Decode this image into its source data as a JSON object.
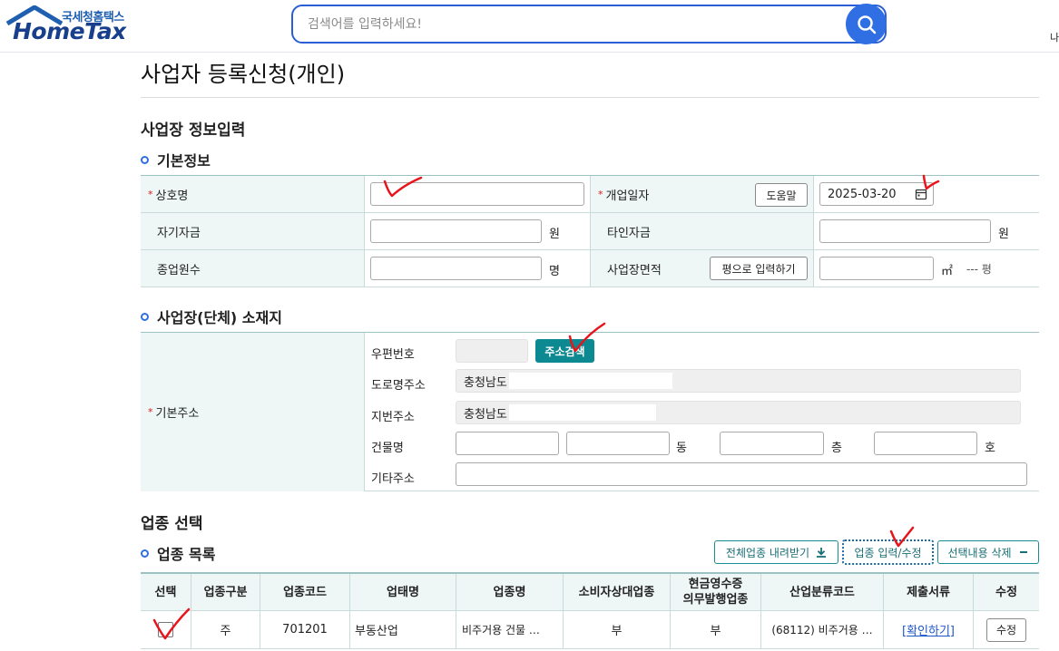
{
  "header": {
    "logo_sub": "국세청홈택스",
    "logo_main": "HomeTax",
    "search_placeholder": "검색어를 입력하세요!",
    "edge_text": "나"
  },
  "page": {
    "title": "사업자 등록신청(개인)",
    "section_title": "사업장 정보입력"
  },
  "basic_info": {
    "title": "기본정보",
    "trade_name_label": "상호명",
    "trade_name_value": "",
    "open_date_label": "개업일자",
    "help_button": "도움말",
    "open_date_value": "2025-03-20",
    "own_capital_label": "자기자금",
    "own_capital_unit": "원",
    "other_capital_label": "타인자금",
    "other_capital_unit": "원",
    "employees_label": "종업원수",
    "employees_unit": "명",
    "area_label": "사업장면적",
    "area_pyeong_button": "평으로 입력하기",
    "area_unit": "㎡",
    "pyeong_text": "--- 평"
  },
  "location": {
    "title": "사업장(단체) 소재지",
    "basic_address_label": "기본주소",
    "zip_label": "우편번호",
    "zip_value": "",
    "address_search_button": "주소검색",
    "road_address_label": "도로명주소",
    "road_address_value": "충청남도",
    "lot_address_label": "지번주소",
    "lot_address_value": "충청남도",
    "building_label": "건물명",
    "dong_unit": "동",
    "floor_unit": "층",
    "ho_unit": "호",
    "other_address_label": "기타주소"
  },
  "industry": {
    "section_title": "업종 선택",
    "list_title": "업종 목록",
    "download_all_button": "전체업종 내려받기",
    "input_edit_button": "업종 입력/수정",
    "delete_selected_button": "선택내용 삭제",
    "columns": [
      "선택",
      "업종구분",
      "업종코드",
      "업태명",
      "업종명",
      "소비자상대업종",
      "현금영수증\n의무발행업종",
      "산업분류코드",
      "제출서류",
      "수정"
    ],
    "rows": [
      {
        "type": "주",
        "code": "701201",
        "business_type": "부동산업",
        "industry_name": "비주거용 건물 …",
        "consumer": "부",
        "cash_receipt": "부",
        "ksic": "(68112) 비주거용 …",
        "documents": "[확인하기]",
        "edit": "수정"
      }
    ]
  },
  "colors": {
    "accent_blue": "#2f6fe3",
    "teal": "#0d8a91",
    "label_bg": "#eef6f6",
    "check_mark": "#e8141b"
  }
}
